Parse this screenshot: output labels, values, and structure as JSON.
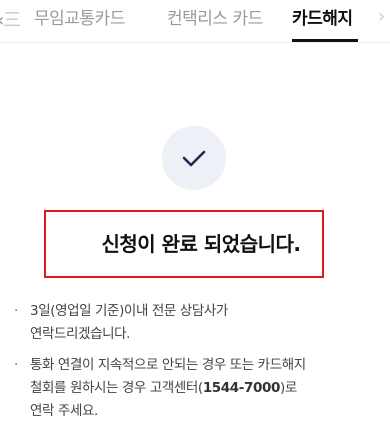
{
  "tabs": {
    "prev_partial": "三",
    "items": [
      {
        "label": "무임교통카드",
        "active": false
      },
      {
        "label": "컨택리스 카드",
        "active": false
      },
      {
        "label": "카드해지",
        "active": true
      }
    ]
  },
  "icons": {
    "prev": "chevron-left-icon",
    "next": "chevron-right-icon",
    "status": "check-icon"
  },
  "result": {
    "message": "신청이 완료 되었습니다."
  },
  "notices": {
    "item1_line1": "3일(영업일 기준)이내 전문 상담사가",
    "item1_line2": "연락드리겠습니다.",
    "item2_line1": "통화 연결이 지속적으로 안되는 경우 또는 카드해지",
    "item2_line2_pre": "철회를 원하시는 경우 고객센터(",
    "item2_phone": "1544-7000",
    "item2_line2_post": ")로",
    "item2_line3": "연락 주세요."
  },
  "colors": {
    "highlight_border": "#e01818",
    "icon_bg": "#eef0f7",
    "icon_stroke": "#1f2a4d"
  }
}
